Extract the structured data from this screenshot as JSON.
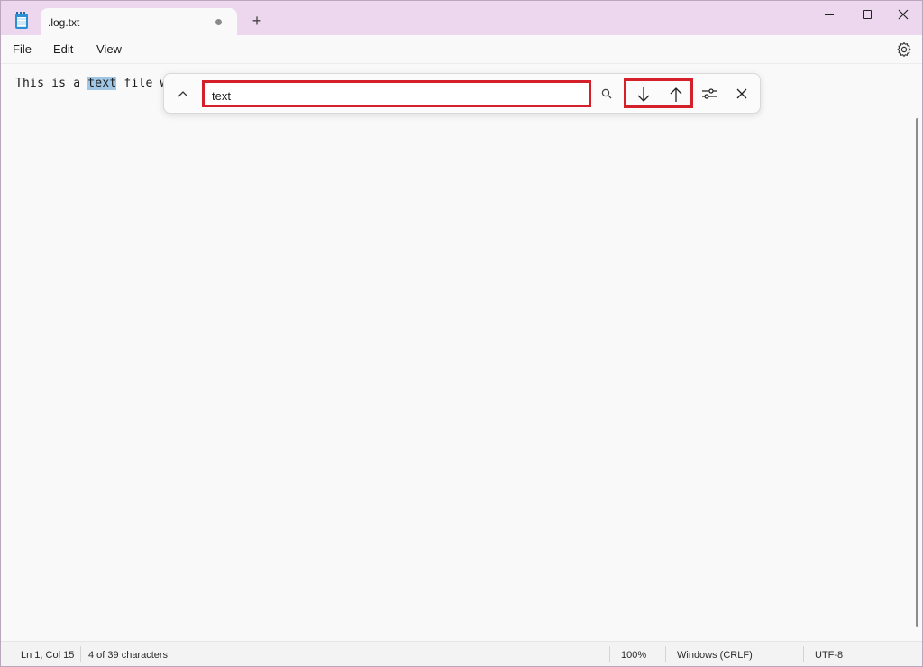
{
  "tab": {
    "title": ".log.txt",
    "unsaved_indicator": "unsaved-dot-icon"
  },
  "new_tab_label": "+",
  "menu": {
    "file": "File",
    "edit": "Edit",
    "view": "View"
  },
  "editor": {
    "text_before": "This is a ",
    "match_text": "text",
    "text_after": " file wri"
  },
  "find": {
    "query": "text",
    "icons": {
      "collapse": "chevron-up-icon",
      "search": "search-icon",
      "next": "arrow-down-icon",
      "previous": "arrow-up-icon",
      "options": "sliders-icon",
      "close": "close-icon"
    }
  },
  "status": {
    "position": "Ln 1, Col 15",
    "characters": "4 of 39 characters",
    "zoom": "100%",
    "line_endings": "Windows (CRLF)",
    "encoding": "UTF-8"
  },
  "colors": {
    "titlebar": "#ecd7ee",
    "highlight": "#9fc6e4",
    "callout_border": "#d3202b"
  }
}
